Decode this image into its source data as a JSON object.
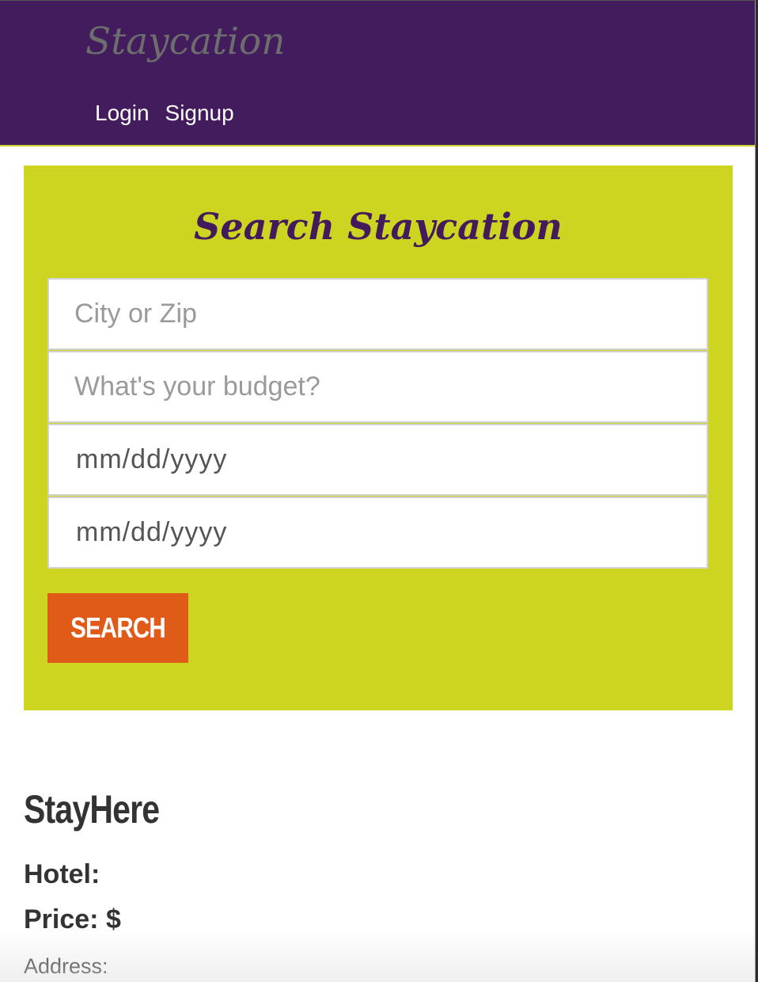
{
  "navbar": {
    "brand": "Staycation",
    "links": [
      "Login",
      "Signup"
    ],
    "bg_color": "#421c5c"
  },
  "search": {
    "title": "Search Staycation",
    "city_placeholder": "City or Zip",
    "budget_placeholder": "What's your budget?",
    "start_date_placeholder": "mm/dd/yyyy",
    "end_date_placeholder": "mm/dd/yyyy",
    "button_label": "SEARCH",
    "panel_color": "#cdd520",
    "button_color": "#e05a18"
  },
  "result": {
    "title": "StayHere",
    "hotel_label": "Hotel:",
    "price_label": "Price: $",
    "address_label": "Address:"
  }
}
